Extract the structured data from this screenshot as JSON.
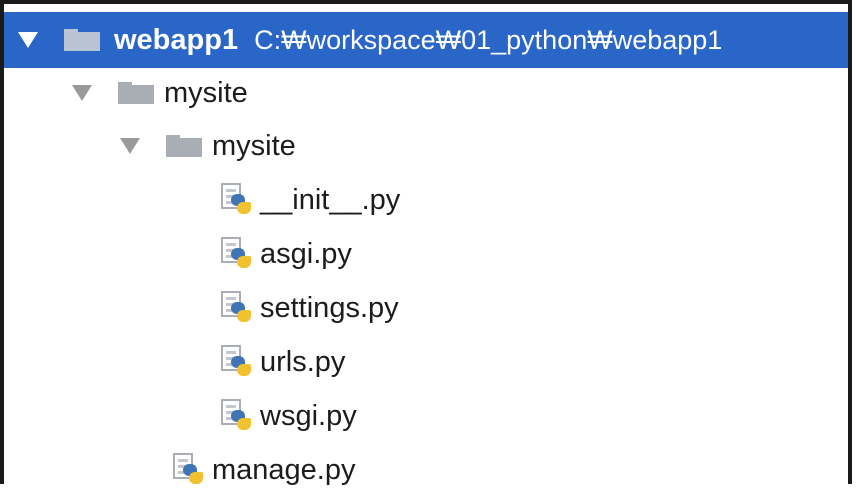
{
  "project": {
    "name": "webapp1",
    "path": "C:₩workspace₩01_python₩webapp1"
  },
  "tree": {
    "folder_outer": "mysite",
    "folder_inner": "mysite",
    "files_inner": [
      "__init__.py",
      "asgi.py",
      "settings.py",
      "urls.py",
      "wsgi.py"
    ],
    "file_outer": "manage.py"
  },
  "colors": {
    "selection": "#2a65c8",
    "folder_icon": "#a9aeb5",
    "python_blue": "#3f74b5",
    "python_yellow": "#f2c22e"
  },
  "icons": {
    "expand": "triangle-down-icon",
    "folder": "folder-icon",
    "python_file": "python-file-icon"
  }
}
